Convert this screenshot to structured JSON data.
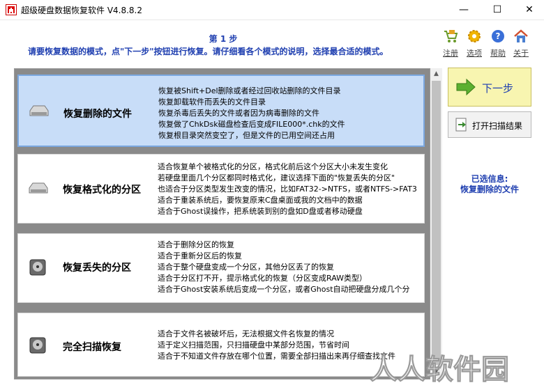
{
  "window": {
    "title": "超级硬盘数据恢复软件 V4.8.8.2",
    "minimize": "—",
    "maximize": "☐",
    "close": "✕"
  },
  "header": {
    "step": "第 1 步",
    "description": "请要恢复数据的模式，点\"下一步\"按钮进行恢复。请仔细看各个模式的说明，选择最合适的模式。"
  },
  "toolbar": [
    {
      "label": "注册",
      "icon": "cart-icon",
      "color": "#e3a324"
    },
    {
      "label": "选项",
      "icon": "gear-icon",
      "color": "#f0b400"
    },
    {
      "label": "帮助",
      "icon": "help-icon",
      "color": "#3a6fd8"
    },
    {
      "label": "关于",
      "icon": "home-icon",
      "color": "#d05030"
    }
  ],
  "options": [
    {
      "name": "恢复删除的文件",
      "icon": "disk-icon",
      "selected": true,
      "lines": [
        "恢复被Shift+Del删除或者经过回收站删除的文件目录",
        "恢复卸载软件而丢失的文件目录",
        "恢复杀毒后丢失的文件或者因为病毒删除的文件",
        "恢复做了ChkDsk磁盘检查后变成FILE000*.chk的文件",
        "恢复根目录突然变空了，但是文件的已用空间还占用"
      ]
    },
    {
      "name": "恢复格式化的分区",
      "icon": "disk-icon",
      "selected": false,
      "lines": [
        "适合恢复单个被格式化的分区，格式化前后这个分区大小未发生变化",
        "若硬盘里面几个分区都同时格式化，建议选择下面的\"恢复丢失的分区\"",
        "也适合于分区类型发生改变的情况，比如FAT32->NTFS，或者NTFS->FAT3",
        "适合于重装系统后，要恢复原来C盘桌面或我的文档中的数据",
        "适合于Ghost误操作，把系统装到别的盘如D盘或者移动硬盘"
      ]
    },
    {
      "name": "恢复丢失的分区",
      "icon": "hard-drive-icon",
      "selected": false,
      "lines": [
        "适合于删除分区的恢复",
        "适合于重新分区后的恢复",
        "适合于整个硬盘变成一个分区，其他分区丢了的恢复",
        "适合于分区打不开，提示格式化的恢复（分区变成RAW类型）",
        "适合于Ghost安装系统后变成一个分区，或者Ghost自动把硬盘分成几个分"
      ]
    },
    {
      "name": "完全扫描恢复",
      "icon": "hard-drive-icon",
      "selected": false,
      "lines": [
        "适合于文件名被破坏后，无法根据文件名恢复的情况",
        "适于定义扫描范围，只扫描硬盘中某部分范围，节省时间",
        "适合于不知道文件存放在哪个位置，需要全部扫描出来再仔细查找文件"
      ]
    }
  ],
  "actions": {
    "next": "下一步",
    "open_scan": "打开扫描结果"
  },
  "selected_info": {
    "label": "已选信息:",
    "value": "恢复删除的文件"
  },
  "watermark": "人人软件园"
}
